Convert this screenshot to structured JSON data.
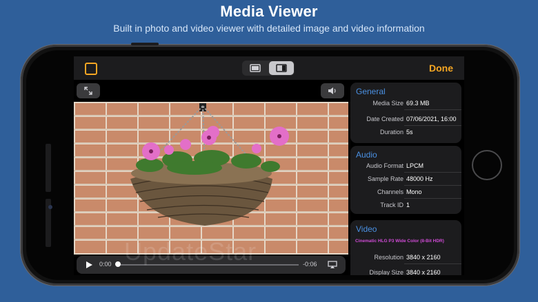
{
  "header": {
    "title": "Media Viewer",
    "subtitle": "Built in photo and video viewer with detailed image and video information"
  },
  "toolbar": {
    "done_label": "Done"
  },
  "player": {
    "current_time": "0:00",
    "remaining_time": "-0:06"
  },
  "info": {
    "general": {
      "title": "General",
      "rows": [
        {
          "key": "Media Size",
          "value": "69.3 MB"
        },
        {
          "key": "Date Created",
          "value": "07/06/2021, 16:00"
        },
        {
          "key": "Duration",
          "value": "5s"
        }
      ]
    },
    "audio": {
      "title": "Audio",
      "rows": [
        {
          "key": "Audio Format",
          "value": "LPCM"
        },
        {
          "key": "Sample Rate",
          "value": "48000 Hz"
        },
        {
          "key": "Channels",
          "value": "Mono"
        },
        {
          "key": "Track ID",
          "value": "1"
        }
      ]
    },
    "video": {
      "title": "Video",
      "badge": "Cinematic HLG P3 Wide Color (8-Bit HDR)",
      "rows": [
        {
          "key": "Resolution",
          "value": "3840 x 2160"
        },
        {
          "key": "Display Size",
          "value": "3840 x 2160"
        }
      ]
    }
  },
  "watermark": "UpdateStar",
  "colors": {
    "accent": "#f5a623",
    "section_header": "#4a90e2",
    "hdr_badge": "#d04bd6",
    "background": "#2f5f9a"
  }
}
